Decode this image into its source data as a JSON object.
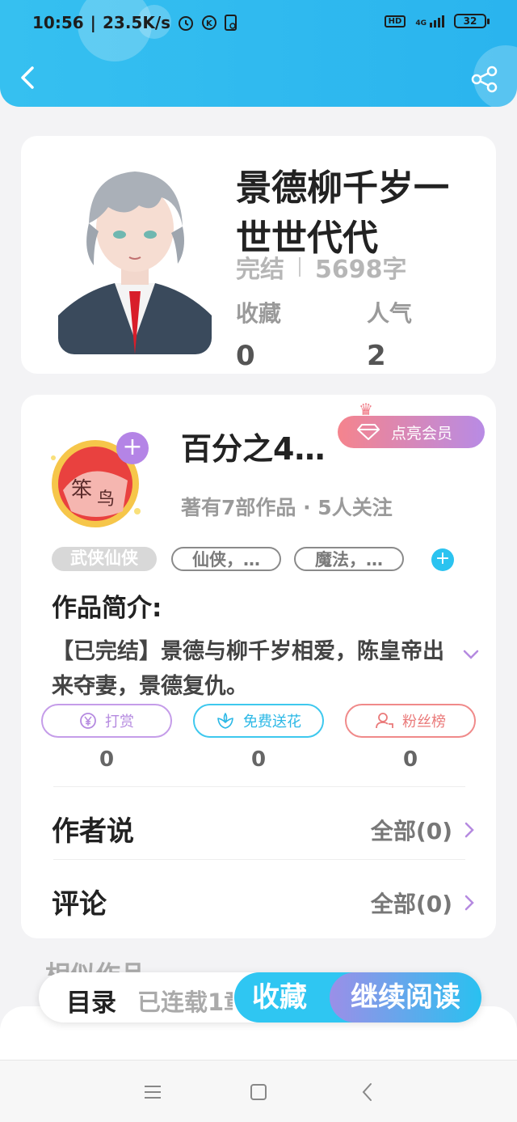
{
  "status_bar": {
    "time": "10:56",
    "speed": "23.5K/s",
    "network": "HD",
    "signal": "4G",
    "battery": "32"
  },
  "book": {
    "title": "景德柳千岁一世世代代",
    "status": "完结",
    "word_count": "5698字",
    "favorites_label": "收藏",
    "favorites_value": "0",
    "popularity_label": "人气",
    "popularity_value": "2"
  },
  "author": {
    "name": "百分之4…",
    "vip_button": "点亮会员",
    "stats": "著有7部作品 · 5人关注"
  },
  "tags": [
    "武侠仙侠",
    "仙侠，…",
    "魔法，…"
  ],
  "intro": {
    "heading": "作品简介:",
    "text": "【已完结】景德与柳千岁相爱，陈皇帝出来夺妻，景德复仇。"
  },
  "actions": {
    "tip_label": "打赏",
    "tip_count": "0",
    "flower_label": "免费送花",
    "flower_count": "0",
    "fans_label": "粉丝榜",
    "fans_count": "0"
  },
  "sections": {
    "author_says": "作者说",
    "author_says_link": "全部(0)",
    "comments": "评论",
    "comments_link": "全部(0)",
    "similar": "相似作品"
  },
  "bottom_bar": {
    "toc": "目录",
    "serial": "已连载1章",
    "collect": "收藏",
    "continue": "继续阅读"
  },
  "colors": {
    "primary": "#2ab4ee",
    "vip_start": "#f5848d",
    "vip_end": "#b88be5"
  }
}
